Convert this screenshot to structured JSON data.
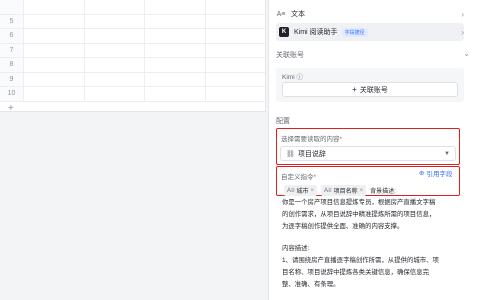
{
  "sheet": {
    "row_numbers": [
      "5",
      "6",
      "7",
      "8",
      "9",
      "10"
    ],
    "add_row_label": "+"
  },
  "panel": {
    "items": [
      {
        "icon": "A≡",
        "label": "文本",
        "badge": ""
      },
      {
        "icon": "K",
        "label": "Kimi 阅读助手",
        "badge": "字段捷径"
      }
    ],
    "linked_account_section": "关联账号",
    "kimi_label": "Kimi ⓘ",
    "link_button_label": "关联账号",
    "config_label": "配置",
    "select_field": {
      "title": "选择需要读取的内容",
      "required_mark": "*",
      "value": "项目说辞"
    },
    "custom_instruction": {
      "title": "自定义指令",
      "required_mark": "*",
      "reference_button": "引用字段",
      "tags": [
        "城市",
        "项目名称"
      ],
      "tag_prefix": "A≡",
      "after_tags": "背景描述:",
      "lines": [
        "你是一个房产项目信息提炼专员，根据房产直播文字稿",
        "的创作需求，从项目说辞中精准提炼所需的项目信息，",
        "为逐字稿创作提供全面、准确的内容支撑。",
        "",
        "内容描述:",
        "1、请围绕房产直播逐字稿创作所需，从提供的城市、项",
        "目名称、项目说辞中提炼各类关键信息，确保信息完",
        "整、准确、有条理。"
      ]
    }
  }
}
